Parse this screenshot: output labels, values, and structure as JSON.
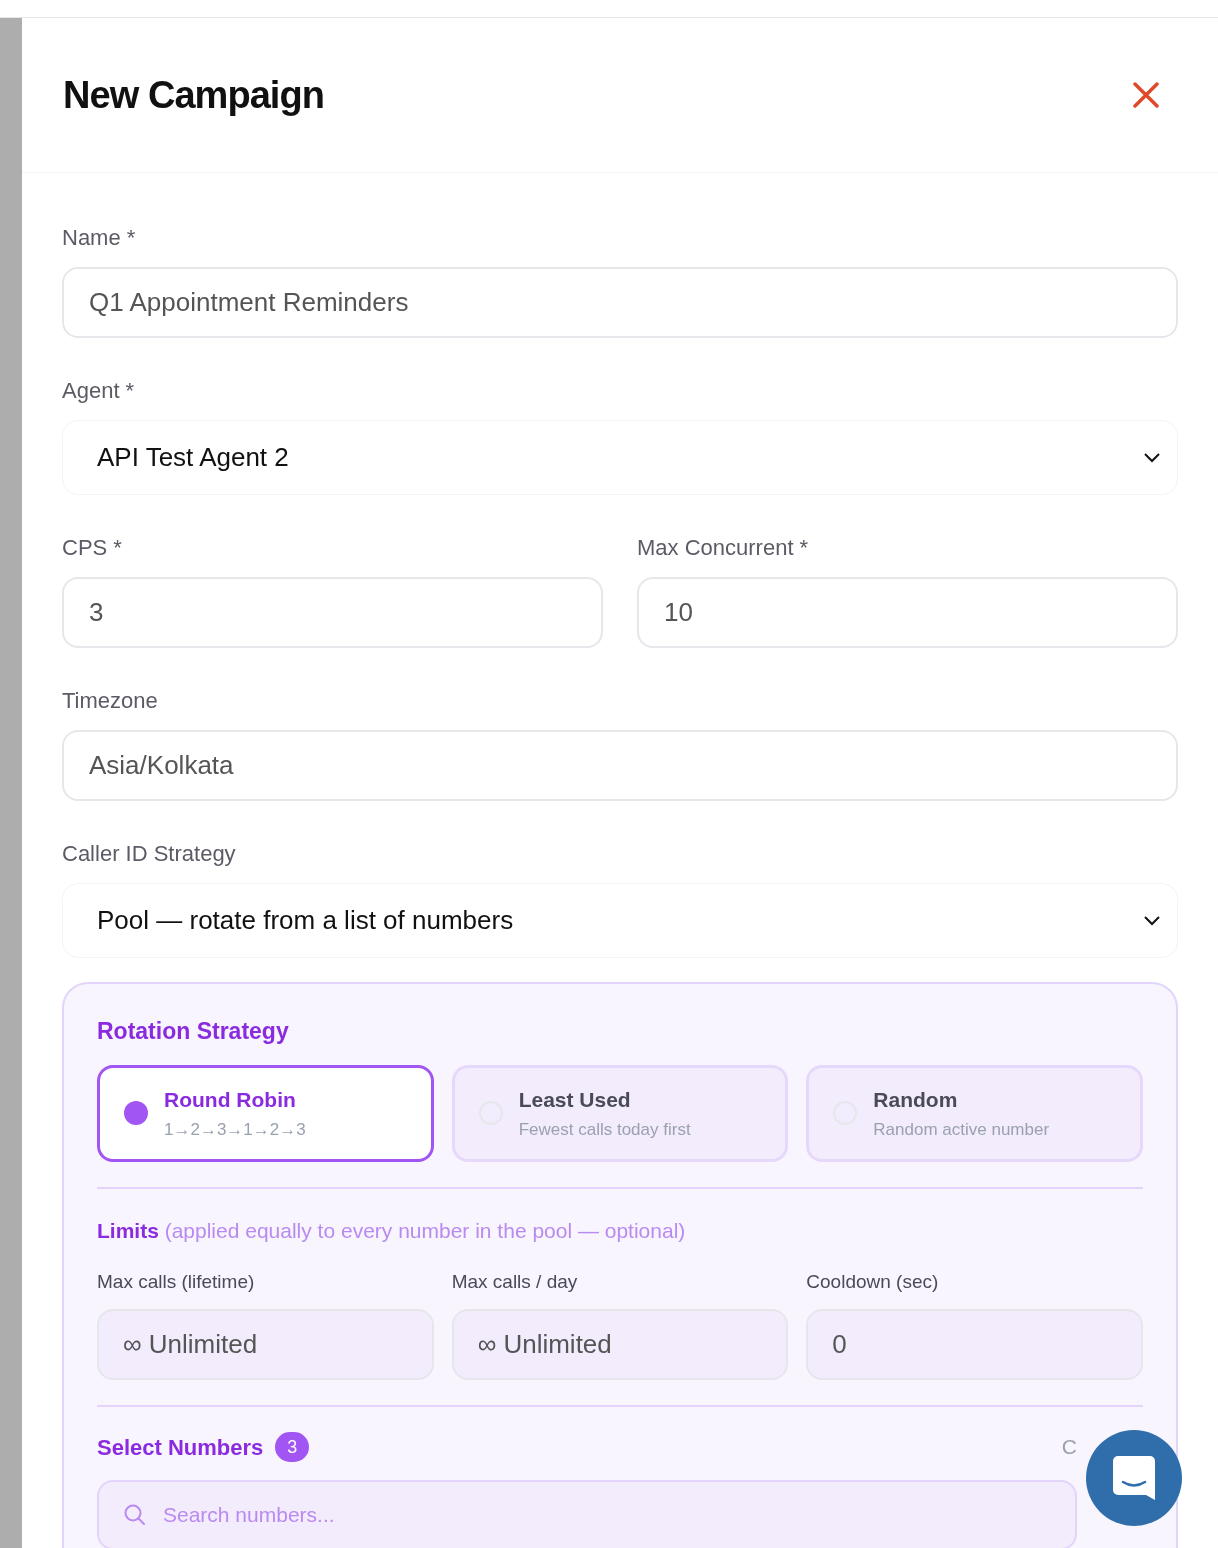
{
  "dialog": {
    "title": "New Campaign"
  },
  "rows": [
    [
      {
        "label": "Name *",
        "value": "Q1 Appointment Reminders",
        "kind": "input"
      }
    ],
    [
      {
        "label": "Agent *",
        "value": "API Test Agent 2",
        "kind": "select"
      }
    ],
    [
      {
        "label": "CPS *",
        "value": "3",
        "kind": "input"
      },
      {
        "label": "Max Concurrent *",
        "value": "10",
        "kind": "input"
      }
    ],
    [
      {
        "label": "Timezone",
        "value": "Asia/Kolkata",
        "kind": "input"
      }
    ],
    [
      {
        "label": "Caller ID Strategy",
        "value": "Pool — rotate from a list of numbers",
        "kind": "select"
      }
    ]
  ],
  "pool": {
    "rotation_title": "Rotation Strategy",
    "options": [
      {
        "title": "Round Robin",
        "subtitle": "1→2→3→1→2→3",
        "selected": true
      },
      {
        "title": "Least Used",
        "subtitle": "Fewest calls today first",
        "selected": false
      },
      {
        "title": "Random",
        "subtitle": "Random active number",
        "selected": false
      }
    ],
    "limits_title": "Limits",
    "limits_note": "(applied equally to every number in the pool — optional)",
    "limits": [
      {
        "label": "Max calls (lifetime)",
        "value": "∞ Unlimited"
      },
      {
        "label": "Max calls / day",
        "value": "∞ Unlimited"
      },
      {
        "label": "Cooldown (sec)",
        "value": "0"
      }
    ],
    "numbers_title": "Select Numbers",
    "numbers_count": "3",
    "numbers_side_text": "C",
    "search_placeholder": "Search numbers..."
  }
}
